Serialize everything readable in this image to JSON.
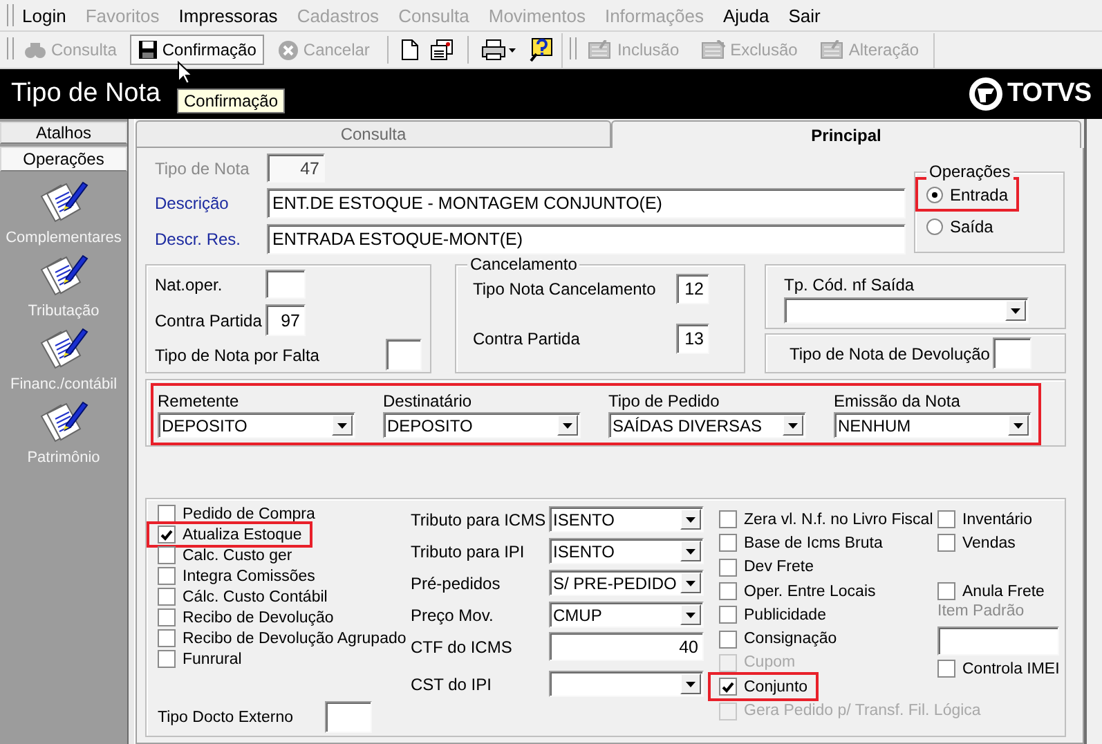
{
  "menu": [
    {
      "label": "Login",
      "disabled": false
    },
    {
      "label": "Favoritos",
      "disabled": true
    },
    {
      "label": "Impressoras",
      "disabled": false
    },
    {
      "label": "Cadastros",
      "disabled": true
    },
    {
      "label": "Consulta",
      "disabled": true
    },
    {
      "label": "Movimentos",
      "disabled": true
    },
    {
      "label": "Informações",
      "disabled": true
    },
    {
      "label": "Ajuda",
      "disabled": false
    },
    {
      "label": "Sair",
      "disabled": false
    }
  ],
  "toolbar": {
    "buttons": [
      {
        "label": "Consulta",
        "disabled": true,
        "hovered": false
      },
      {
        "label": "Confirmação",
        "disabled": false,
        "hovered": true
      },
      {
        "label": "Cancelar",
        "disabled": true,
        "hovered": false
      }
    ],
    "edit_buttons": [
      {
        "label": "Inclusão",
        "disabled": true
      },
      {
        "label": "Exclusão",
        "disabled": true
      },
      {
        "label": "Alteração",
        "disabled": true
      }
    ]
  },
  "tooltip": "Confirmação",
  "window_title": "Tipo de Nota",
  "logo": "TOTVS",
  "sidebar": {
    "tabs": [
      {
        "label": "Atalhos",
        "selected": false
      },
      {
        "label": "Operações",
        "selected": true
      }
    ],
    "items": [
      "Complementares",
      "Tributação",
      "Financ./contábil",
      "Patrimônio"
    ]
  },
  "tabs": [
    {
      "label": "Consulta",
      "selected": false
    },
    {
      "label": "Principal",
      "selected": true
    }
  ],
  "form": {
    "tipo_de_nota": {
      "label": "Tipo de Nota",
      "value": "47",
      "disabled": true
    },
    "descricao": {
      "label": "Descrição",
      "value": "ENT.DE ESTOQUE - MONTAGEM CONJUNTO(E)"
    },
    "descr_res": {
      "label": "Descr. Res.",
      "value": "ENTRADA ESTOQUE-MONT(E)"
    },
    "operacoes": {
      "title": "Operações",
      "options": [
        {
          "label": "Entrada",
          "selected": true,
          "highlighted": true
        },
        {
          "label": "Saída",
          "selected": false,
          "highlighted": false
        }
      ]
    },
    "nat_oper": {
      "label": "Nat.oper."
    },
    "contra_partida": {
      "label": "Contra Partida",
      "value": "97"
    },
    "tipo_nota_por_falta": {
      "label": "Tipo de Nota por Falta"
    },
    "cancelamento": {
      "title": "Cancelamento",
      "fields": [
        {
          "label": "Tipo Nota Cancelamento",
          "value": "12"
        },
        {
          "label": "Contra Partida",
          "value": "13"
        }
      ]
    },
    "tp_cod_nf_saida": {
      "label": "Tp. Cód. nf Saída"
    },
    "tipo_nota_devolucao": {
      "label": "Tipo de Nota de Devolução"
    },
    "parties": {
      "highlighted": true,
      "fields": [
        {
          "label": "Remetente",
          "value": "DEPOSITO"
        },
        {
          "label": "Destinatário",
          "value": "DEPOSITO"
        },
        {
          "label": "Tipo de Pedido",
          "value": "SAÍDAS DIVERSAS"
        },
        {
          "label": "Emissão da Nota",
          "value": "NENHUM"
        }
      ]
    },
    "flags_left": [
      {
        "label": "Pedido de Compra",
        "checked": false,
        "disabled": false,
        "highlighted": false
      },
      {
        "label": "Atualiza Estoque",
        "checked": true,
        "disabled": false,
        "highlighted": true
      },
      {
        "label": "Calc. Custo ger",
        "checked": false,
        "disabled": false,
        "highlighted": false
      },
      {
        "label": "Integra Comissões",
        "checked": false,
        "disabled": false,
        "highlighted": false
      },
      {
        "label": "Cálc. Custo Contábil",
        "checked": false,
        "disabled": false,
        "highlighted": false
      },
      {
        "label": "Recibo de Devolução",
        "checked": false,
        "disabled": false,
        "highlighted": false
      },
      {
        "label": "Recibo de Devolução Agrupado",
        "checked": false,
        "disabled": false,
        "highlighted": false
      },
      {
        "label": "Funrural",
        "checked": false,
        "disabled": false,
        "highlighted": false
      }
    ],
    "tipo_docto_externo": {
      "label": "Tipo Docto Externo"
    },
    "taxes": [
      {
        "kind": "combo",
        "label": "Tributo para ICMS",
        "value": "ISENTO"
      },
      {
        "kind": "combo",
        "label": "Tributo para IPI",
        "value": "ISENTO"
      },
      {
        "kind": "combo",
        "label": "Pré-pedidos",
        "value": "S/ PRE-PEDIDO"
      },
      {
        "kind": "combo",
        "label": "Preço Mov.",
        "value": "CMUP"
      },
      {
        "kind": "input",
        "label": "CTF do ICMS",
        "value": "40"
      },
      {
        "kind": "combo",
        "label": "CST do IPI"
      }
    ],
    "flags_middle": [
      {
        "label": "Zera vl. N.f. no Livro Fiscal",
        "checked": false,
        "disabled": false,
        "highlighted": false
      },
      {
        "label": "Base de Icms Bruta",
        "checked": false,
        "disabled": false,
        "highlighted": false
      },
      {
        "label": "Dev Frete",
        "checked": false,
        "disabled": false,
        "highlighted": false
      },
      {
        "label": "Oper. Entre Locais",
        "checked": false,
        "disabled": false,
        "highlighted": false
      },
      {
        "label": "Publicidade",
        "checked": false,
        "disabled": false,
        "highlighted": false
      },
      {
        "label": "Consignação",
        "checked": false,
        "disabled": false,
        "highlighted": false
      },
      {
        "label": "Cupom",
        "checked": false,
        "disabled": true,
        "highlighted": false
      },
      {
        "label": "Conjunto",
        "checked": true,
        "disabled": false,
        "highlighted": true
      },
      {
        "label": "Gera Pedido p/ Transf. Fil. Lógica",
        "checked": false,
        "disabled": true,
        "highlighted": false
      }
    ],
    "flags_right": [
      {
        "label": "Inventário",
        "checked": false,
        "disabled": false,
        "highlighted": false
      },
      {
        "label": "Vendas",
        "checked": false,
        "disabled": false,
        "highlighted": false
      }
    ],
    "anula_frete": {
      "label": "Anula Frete",
      "checked": false,
      "disabled": false,
      "highlighted": false
    },
    "item_padrao": {
      "label": "Item Padrão",
      "disabled": true
    },
    "controla_imei": {
      "label": "Controla IMEI",
      "checked": false,
      "disabled": false,
      "highlighted": false
    }
  }
}
